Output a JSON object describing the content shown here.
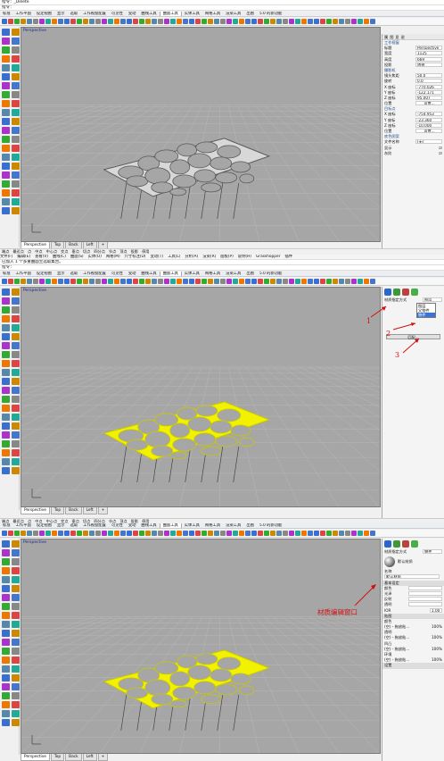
{
  "colors": {
    "viewport_bg": "#a6a6a6",
    "grid_line": "#b8b8b8",
    "model_gray": "#5a5a5a",
    "model_selected": "#f2f200",
    "annotation_red": "#d01010"
  },
  "panel1": {
    "cmd_history": "指令：_Delete",
    "cmd_prompt": "指令："
  },
  "panel2": {
    "cmd_history": "已加入 1 个多重曲面至选取集合。",
    "cmd_prompt": "指令："
  },
  "panel3": {},
  "menu": [
    "文件(F)",
    "编辑(E)",
    "查看(V)",
    "曲线(C)",
    "曲面(S)",
    "实体(O)",
    "网格(M)",
    "尺寸标注(D)",
    "变动(T)",
    "工具(L)",
    "分析(A)",
    "渲染(R)",
    "面板(P)",
    "说明(H)",
    "Grasshopper",
    "插件"
  ],
  "tabs": [
    "标准",
    "工作平面",
    "设定视图",
    "显示",
    "选取",
    "工作视窗配置",
    "可见性",
    "变动",
    "曲线工具",
    "曲面工具",
    "实体工具",
    "网格工具",
    "渲染工具",
    "出图",
    "5.0 的新功能"
  ],
  "active_tab_index": 9,
  "viewport_label": "Perspective",
  "viewport_tabs": [
    "Perspective",
    "Top",
    "Back",
    "Left",
    "+"
  ],
  "osnap": [
    "端点",
    "最近点",
    "点",
    "中点",
    "中心点",
    "交点",
    "垂点",
    "切点",
    "四分点",
    "节点",
    "顶点",
    "投影",
    "停用"
  ],
  "status_bar": "工作平面 x y z 米 ■默认值 锁定格点 正交 平面模式 物件锁点 智慧轨迹 操作轴 记录建构历史 过滤器",
  "props": {
    "tabs": [
      "属",
      "图",
      "显",
      "说"
    ],
    "section_view": "工作视窗",
    "title_label": "标题",
    "title_value": "Perspective",
    "width_label": "宽度",
    "width_value": "1125",
    "height_label": "高度",
    "height_value": "669",
    "projection_label": "投影",
    "projection_value": "透视",
    "section_camera": "摄影机",
    "lens_label": "镜头焦距",
    "lens_value": "50.0",
    "rotation_label": "旋转",
    "rotation_value": "0.0",
    "x_label": "X 座标",
    "x_value": "-770.026",
    "y_label": "Y 座标",
    "y_value": "-122.171",
    "z_label": "Z 座标",
    "z_value": "95.007",
    "position_label": "位置",
    "position_button": "设置...",
    "section_target": "目标点",
    "tx_value": "-754.953",
    "ty_value": "-23.360",
    "tz_value": "-10.000",
    "section_wallpaper": "底色图案",
    "filename_label": "文件名称",
    "filename_value": "(无)",
    "show_label": "显示",
    "gray_label": "灰阶"
  },
  "material": {
    "assign_label": "材质指定方式",
    "assign_value": "图层",
    "dropdown_options": [
      "图层",
      "父物件",
      "物件"
    ],
    "match_button": "匹配...",
    "default_material": "默认材质",
    "name_label": "名称",
    "name_value": "默认材质",
    "basic_section": "基本设定",
    "color_label": "颜色",
    "gloss_label": "光泽",
    "reflect_label": "反射",
    "transp_label": "透明",
    "ior_label": "IOR",
    "ior_value": "1.00",
    "map_section": "贴图",
    "map_color": "颜色",
    "map_transp": "透明",
    "map_bump": "凹凸",
    "map_env": "环境",
    "map_none": "(空) - 拖放贴…",
    "map_amount": "100%",
    "settings_section": "设置"
  },
  "annotations": {
    "n1": "1",
    "n2": "2",
    "n3": "3",
    "material_editor": "材质编辑窗口"
  }
}
